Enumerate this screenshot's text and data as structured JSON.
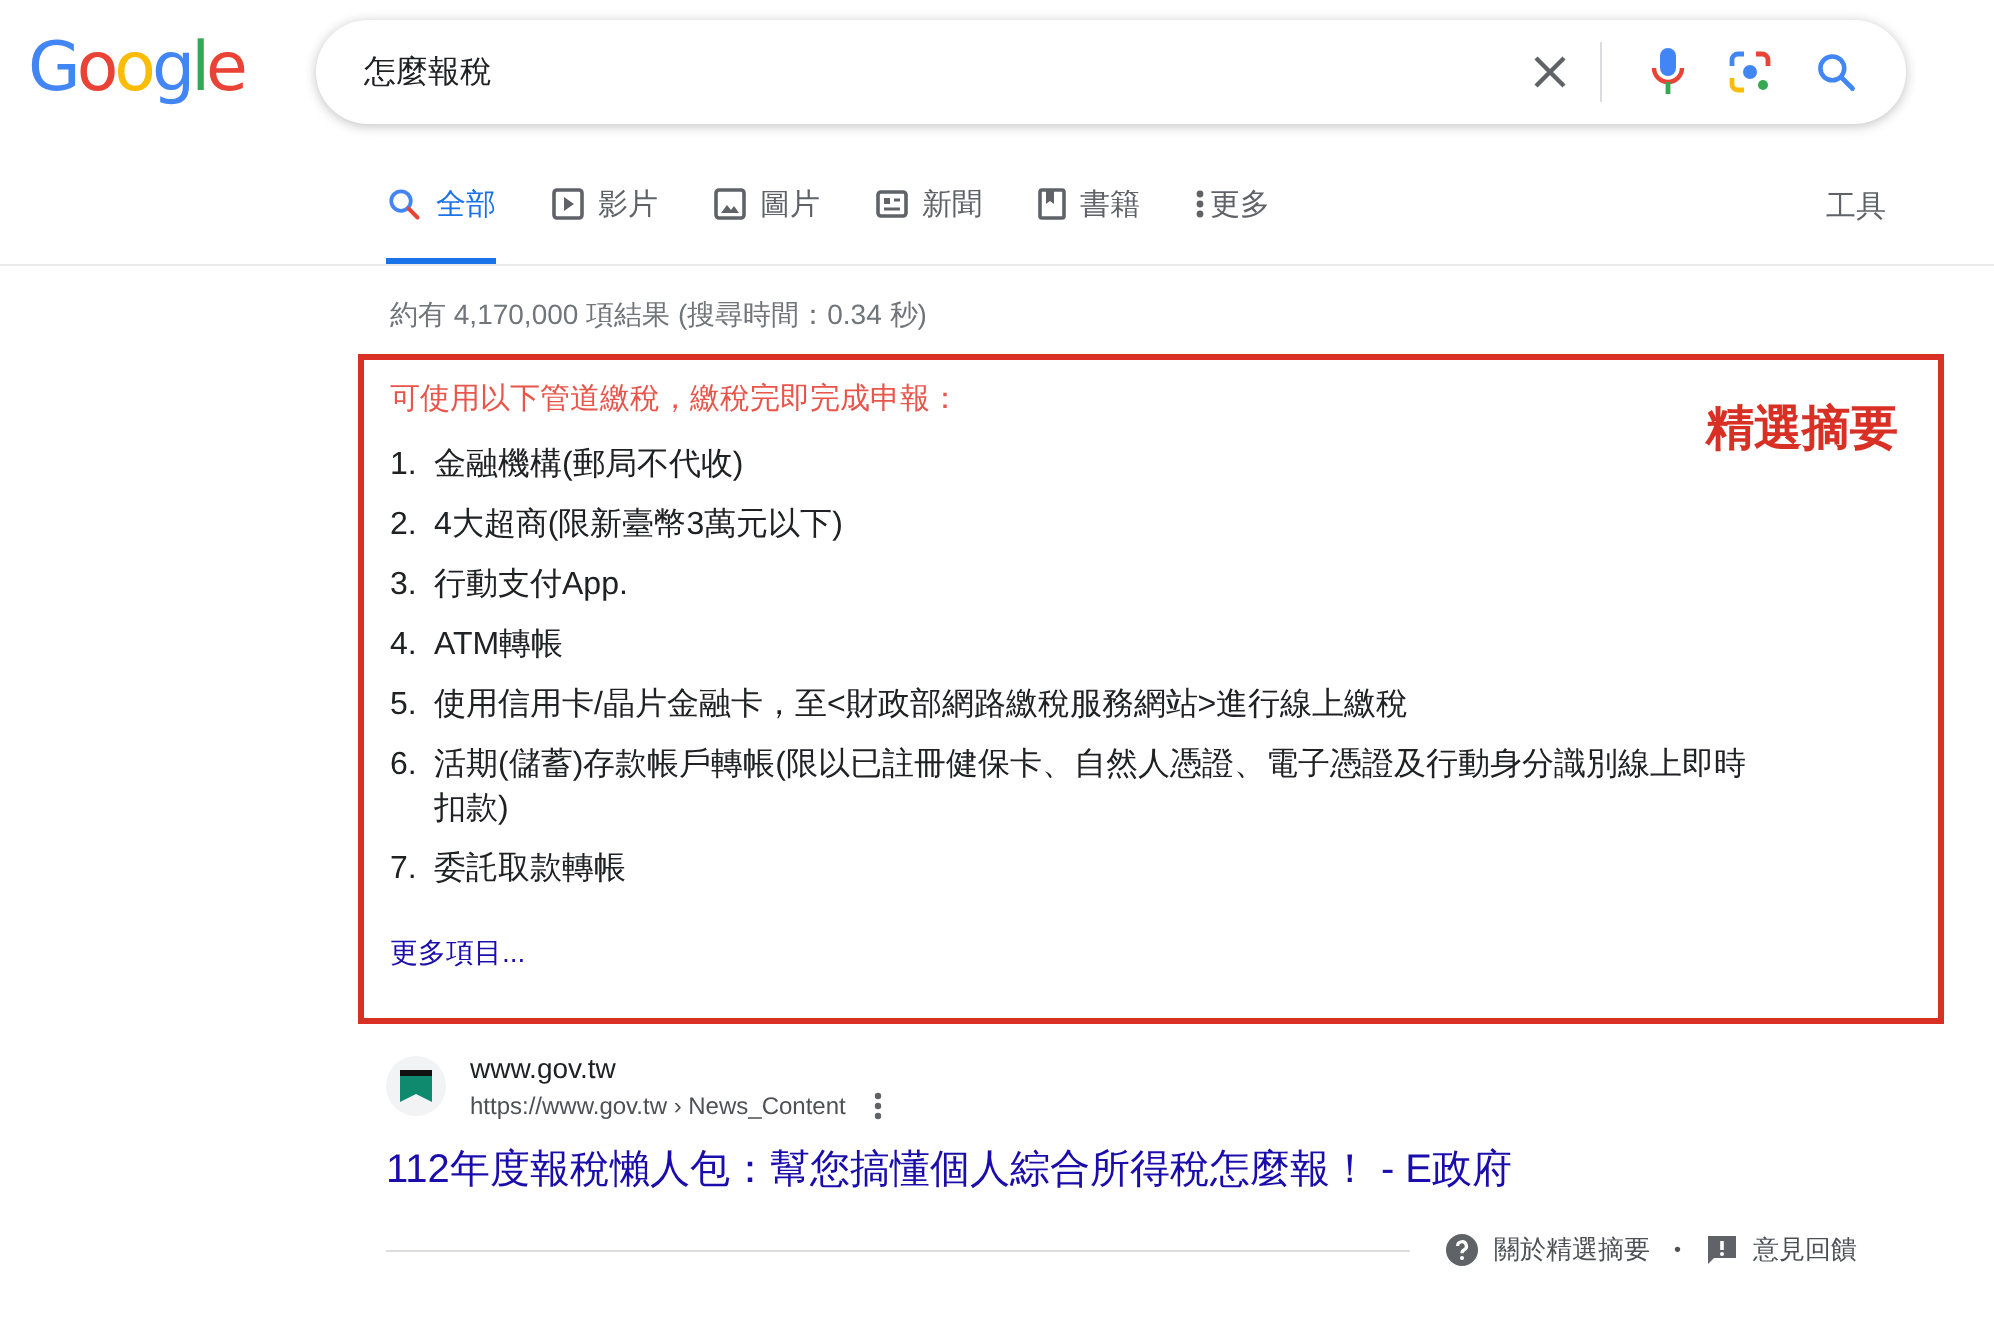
{
  "logo": "Google",
  "search": {
    "value": "怎麼報稅"
  },
  "tabs": [
    {
      "kind": "all",
      "label": "全部",
      "selected": true
    },
    {
      "kind": "videos",
      "label": "影片",
      "selected": false
    },
    {
      "kind": "images",
      "label": "圖片",
      "selected": false
    },
    {
      "kind": "news",
      "label": "新聞",
      "selected": false
    },
    {
      "kind": "books",
      "label": "書籍",
      "selected": false
    },
    {
      "kind": "more",
      "label": "更多",
      "selected": false
    }
  ],
  "tools": "工具",
  "result_stats": "約有 4,170,000 項結果 (搜尋時間：0.34 秒)",
  "featured_snippet": {
    "heading": "可使用以下管道繳稅，繳稅完即完成申報：",
    "annotation": "精選摘要",
    "items": [
      {
        "number": "1.",
        "text": "金融機構(郵局不代收)"
      },
      {
        "number": "2.",
        "text": "4大超商(限新臺幣3萬元以下)"
      },
      {
        "number": "3.",
        "text": "行動支付App."
      },
      {
        "number": "4.",
        "text": "ATM轉帳"
      },
      {
        "number": "5.",
        "text": "使用信用卡/晶片金融卡，至<財政部網路繳稅服務網站>進行線上繳稅"
      },
      {
        "number": "6.",
        "text": "活期(儲蓄)存款帳戶轉帳(限以已註冊健保卡、自然人憑證、電子憑證及行動身分識別線上即時扣款)"
      },
      {
        "number": "7.",
        "text": "委託取款轉帳"
      }
    ],
    "more_link": "更多項目..."
  },
  "result": {
    "site": "www.gov.tw",
    "url": "https://www.gov.tw › News_Content",
    "title": "112年度報稅懶人包：幫您搞懂個人綜合所得稅怎麼報！ - E政府"
  },
  "footer": {
    "about": "關於精選摘要",
    "separator": "•",
    "feedback": "意見回饋"
  }
}
